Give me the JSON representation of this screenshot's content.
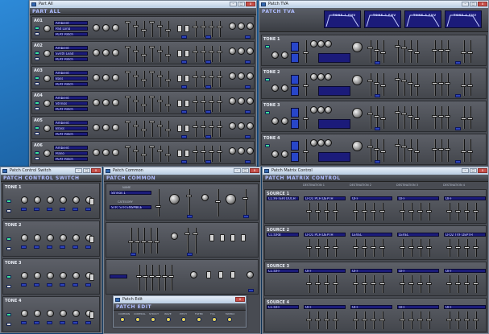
{
  "windows": {
    "part_all": {
      "title": "Part All",
      "header": "PART ALL",
      "rows": [
        {
          "label": "A01",
          "disp1": "Ambient",
          "disp2": "Pad Long",
          "disp3": "PLAY Patch"
        },
        {
          "label": "A02",
          "disp1": "Ambient",
          "disp2": "Synth Lead",
          "disp3": "PLAY Patch"
        },
        {
          "label": "A03",
          "disp1": "Ambient",
          "disp2": "Bass",
          "disp3": "PLAY Patch"
        },
        {
          "label": "A04",
          "disp1": "Ambient",
          "disp2": "Strings",
          "disp3": "PLAY Patch"
        },
        {
          "label": "A05",
          "disp1": "Ambient",
          "disp2": "Brass",
          "disp3": "PLAY Patch"
        },
        {
          "label": "A06",
          "disp1": "Ambient",
          "disp2": "Piano",
          "disp3": "PLAY Patch"
        }
      ],
      "extra_btn": "CARD"
    },
    "patch_tva": {
      "title": "Patch TVA",
      "header": "PATCH TVA",
      "env_labels": [
        "TONE 1 ENV",
        "TONE 2 ENV",
        "TONE 3 ENV",
        "TONE 4 ENV"
      ],
      "rows": [
        {
          "label": "TONE 1"
        },
        {
          "label": "TONE 2"
        },
        {
          "label": "TONE 3"
        },
        {
          "label": "TONE 4"
        }
      ],
      "col_labels": {
        "env": "ENV",
        "bias": "BIAS LEVEL",
        "time": "ENV TIME"
      }
    },
    "patch_control_switch": {
      "title": "Patch Control Switch",
      "header": "PATCH CONTROL SWITCH",
      "rows": [
        "TONE 1",
        "TONE 2",
        "TONE 3",
        "TONE 4"
      ]
    },
    "patch_common": {
      "title": "Patch Common",
      "header": "PATCH COMMON",
      "name_label": "NAME",
      "name_value": "Strings 1",
      "category_label": "CATEGORY",
      "category_value": "STR: STR ENSMBLE"
    },
    "patch_matrix_control": {
      "title": "Patch Matrix Control",
      "header": "PATCH MATRIX CONTROL",
      "dest_headers": [
        "DESTINATION 1",
        "DESTINATION 2",
        "DESTINATION 3",
        "DESTINATION 4"
      ],
      "sources": [
        {
          "label": "SOURCE 1",
          "src": "CC:AFTERTOUCH",
          "d1": "LFO1 PCH DEPTH",
          "d2": "OFF",
          "d3": "OFF",
          "d4": "OFF"
        },
        {
          "label": "SOURCE 2",
          "src": "CC:ORB",
          "d1": "LFO1 PCH DEPTH",
          "d2": "LEVEL",
          "d3": "LEVEL",
          "d4": "LFO2 TVF DEPTH"
        },
        {
          "label": "SOURCE 3",
          "src": "CC:OFF",
          "d1": "OFF",
          "d2": "OFF",
          "d3": "OFF",
          "d4": "OFF"
        },
        {
          "label": "SOURCE 4",
          "src": "CC:OFF",
          "d1": "OFF",
          "d2": "OFF",
          "d3": "OFF",
          "d4": "OFF"
        }
      ]
    },
    "patch_edit": {
      "title": "Patch Edit",
      "header": "PATCH EDIT",
      "buttons": [
        "COMMON",
        "CONTROL",
        "STRUCT",
        "WAVE",
        "PITCH",
        "FILTER",
        "TVA",
        "MATRIX"
      ]
    }
  },
  "colors": {
    "panel": "#484b52",
    "display": "#1b1b7a",
    "led": "#3ee39a",
    "header_text": "#aebcff"
  }
}
